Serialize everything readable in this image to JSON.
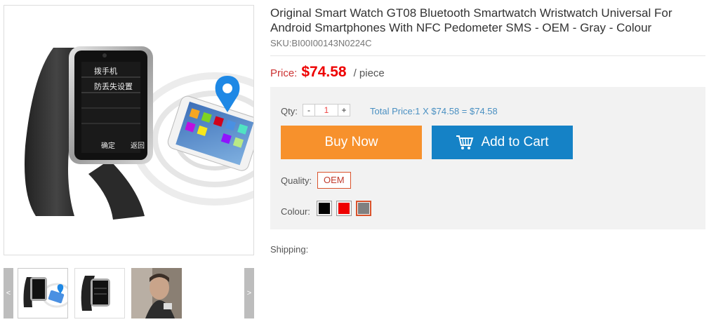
{
  "product": {
    "title": "Original Smart Watch GT08 Bluetooth Smartwatch Wristwatch Universal For Android Smartphones With NFC Pedometer SMS - OEM - Gray - Colour",
    "sku": "SKU:BI00I00143N0224C",
    "price_label": "Price:",
    "price": "$74.58",
    "unit": "/ piece"
  },
  "purchase": {
    "qty_label": "Qty:",
    "minus": "-",
    "plus": "+",
    "qty_value": "1",
    "total": "Total Price:1 X $74.58 = $74.58",
    "buy_now": "Buy Now",
    "add_to_cart": "Add to Cart",
    "quality_label": "Quality:",
    "quality_option": "OEM",
    "colour_label": "Colour:",
    "colours": [
      "#000000",
      "#ee0000",
      "#808080"
    ],
    "selected_colour": "#808080"
  },
  "shipping_label": "Shipping:",
  "gallery": {
    "prev": "<",
    "next": ">"
  },
  "screen_texts": {
    "line1": "拨手机",
    "line2": "防丢失设置",
    "btn_left": "确定",
    "btn_right": "返回"
  }
}
